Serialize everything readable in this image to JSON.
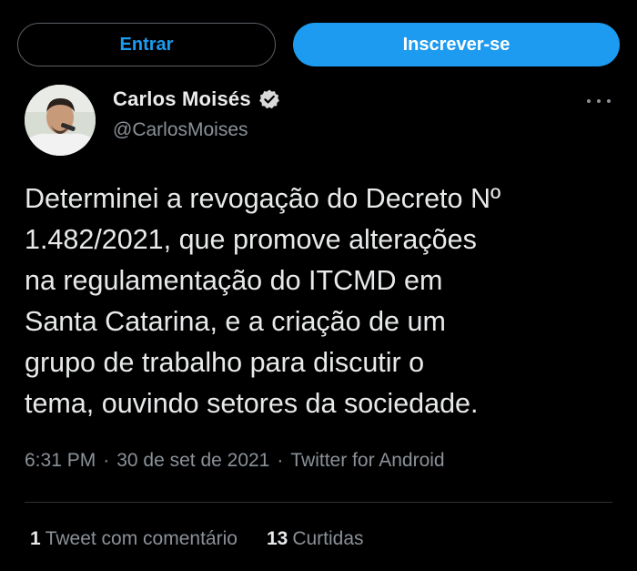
{
  "header": {
    "login_label": "Entrar",
    "signup_label": "Inscrever-se"
  },
  "author": {
    "display_name": "Carlos Moisés",
    "handle": "@CarlosMoises",
    "verified": true
  },
  "tweet": {
    "text": "Determinei a revogação do Decreto Nº\n1.482/2021, que promove alterações\nna regulamentação do ITCMD em\nSanta Catarina, e a criação de um\ngrupo de trabalho para discutir o\ntema, ouvindo setores da sociedade.",
    "time": "6:31 PM",
    "separator": "·",
    "date": "30 de set de 2021",
    "source": "Twitter for Android"
  },
  "stats": {
    "quotes_count": "1",
    "quotes_label": "Tweet com comentário",
    "likes_count": "13",
    "likes_label": "Curtidas"
  },
  "colors": {
    "background": "#000000",
    "accent": "#1d9bf0",
    "muted_text": "#8b9197",
    "primary_text": "#e7e9ea"
  },
  "icons": {
    "verified": "verified-badge-icon",
    "more": "more-horizontal-icon"
  }
}
